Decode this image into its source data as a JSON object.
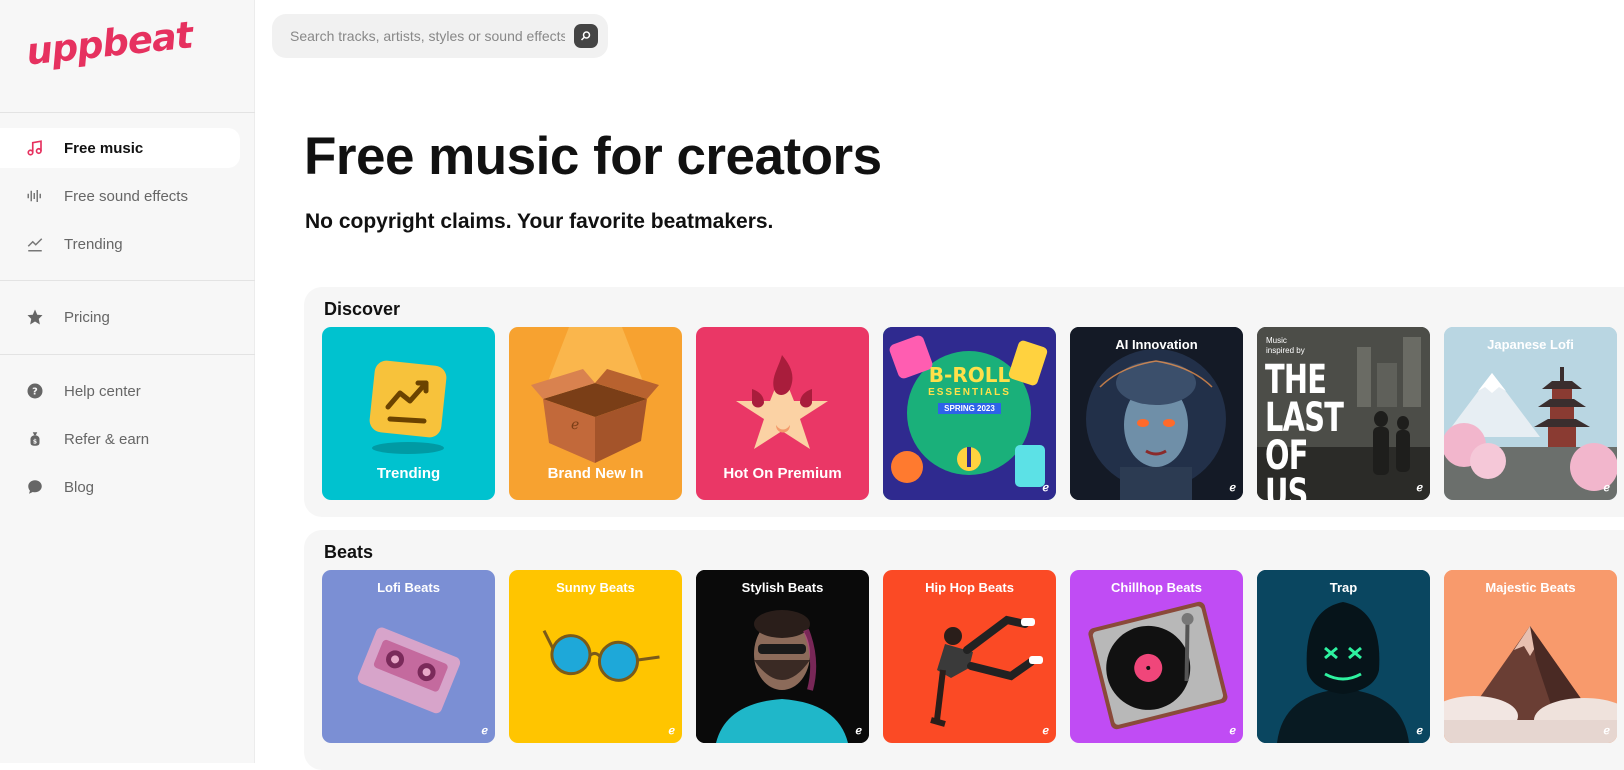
{
  "brand": {
    "logo_text": "uppbeat",
    "accent": "#e6315f"
  },
  "search": {
    "placeholder": "Search tracks, artists, styles or sound effects"
  },
  "sidebar": {
    "primary": [
      {
        "label": "Free music",
        "icon": "music-note-icon",
        "active": true
      },
      {
        "label": "Free sound effects",
        "icon": "waveform-icon",
        "active": false
      },
      {
        "label": "Trending",
        "icon": "trending-chart-icon",
        "active": false
      }
    ],
    "secondary": [
      {
        "label": "Pricing",
        "icon": "star-icon"
      }
    ],
    "tertiary": [
      {
        "label": "Help center",
        "icon": "help-circle-icon"
      },
      {
        "label": "Refer & earn",
        "icon": "money-bag-icon"
      },
      {
        "label": "Blog",
        "icon": "chat-bubble-icon"
      }
    ]
  },
  "hero": {
    "title": "Free music for creators",
    "subtitle": "No copyright claims. Your favorite beatmakers."
  },
  "sections": [
    {
      "title": "Discover",
      "cards": [
        {
          "label": "Trending",
          "label_pos": "bottom",
          "color": "#00c2cf"
        },
        {
          "label": "Brand New In",
          "label_pos": "bottom",
          "color": "#f7a230"
        },
        {
          "label": "Hot On Premium",
          "label_pos": "bottom",
          "color": "#ea3766"
        },
        {
          "label": "",
          "label_pos": "none",
          "color": "#1ab07a",
          "art_title": "B-ROLL",
          "art_sub": "ESSENTIALS",
          "art_tag": "SPRING 2023"
        },
        {
          "label": "AI Innovation",
          "label_pos": "top",
          "color": "#1c2230"
        },
        {
          "label": "",
          "label_pos": "none",
          "color": "#3a3a36",
          "art_small": "Music inspired by",
          "art_big": "THE LAST OF US"
        },
        {
          "label": "Japanese Lofi",
          "label_pos": "top",
          "color": "#a9c8d6"
        }
      ]
    },
    {
      "title": "Beats",
      "cards": [
        {
          "label": "Lofi Beats",
          "label_pos": "top",
          "color": "#7b8fd4"
        },
        {
          "label": "Sunny Beats",
          "label_pos": "top",
          "color": "#ffc500"
        },
        {
          "label": "Stylish Beats",
          "label_pos": "top",
          "color": "#0b0b0b"
        },
        {
          "label": "Hip Hop Beats",
          "label_pos": "top",
          "color": "#fb4a25"
        },
        {
          "label": "Chillhop Beats",
          "label_pos": "top",
          "color": "#c04cf4"
        },
        {
          "label": "Trap",
          "label_pos": "top",
          "color": "#0b4a63"
        },
        {
          "label": "Majestic Beats",
          "label_pos": "top",
          "color": "#fb9865"
        }
      ]
    }
  ],
  "card_badge": "ℯ"
}
